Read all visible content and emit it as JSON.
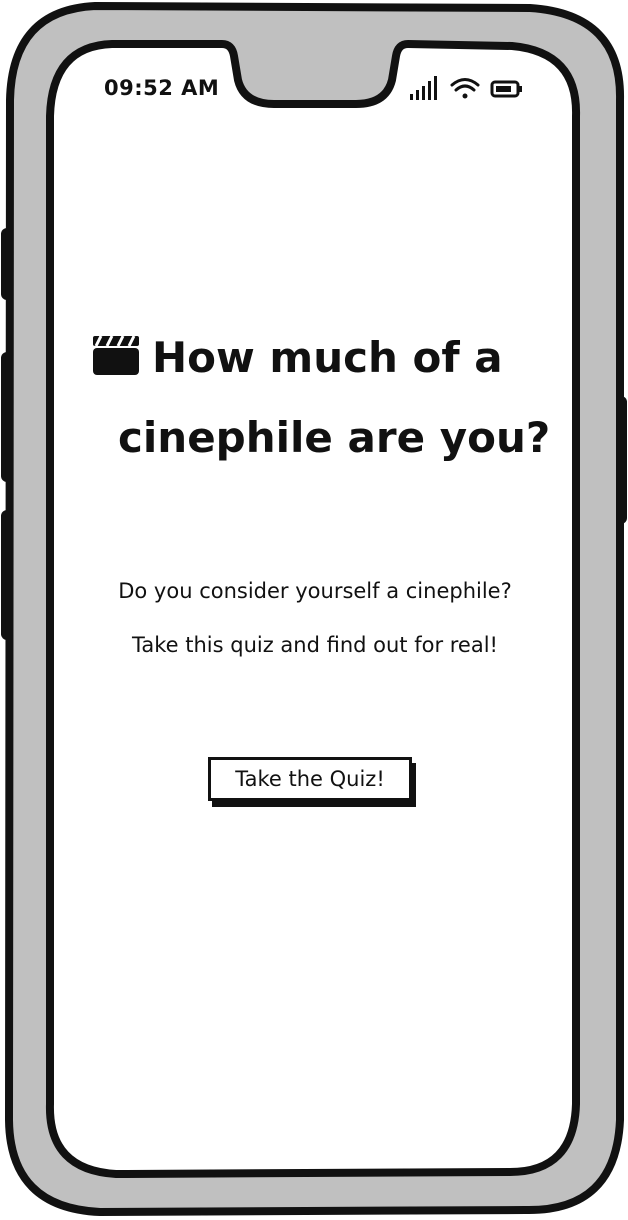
{
  "status_bar": {
    "time": "09:52 AM",
    "icons": [
      "signal-icon",
      "wifi-icon",
      "battery-icon"
    ]
  },
  "hero": {
    "icon": "clapperboard-icon",
    "title_line1": "How much of a",
    "title_line2": "cinephile are you?"
  },
  "intro": {
    "line1": "Do you consider yourself a cinephile?",
    "line2": "Take this quiz and find out for real!"
  },
  "cta": {
    "label": "Take the Quiz!"
  },
  "colors": {
    "frame_fill": "#c0c0c0",
    "stroke": "#111111",
    "screen": "#ffffff"
  }
}
